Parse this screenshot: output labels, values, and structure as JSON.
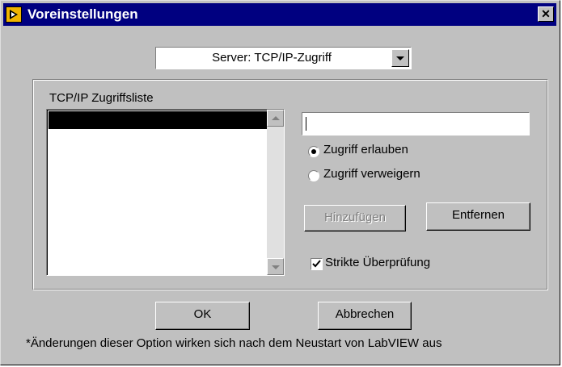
{
  "window": {
    "title": "Voreinstellungen",
    "close_glyph": "✕",
    "icon": "labview-icon"
  },
  "category_select": {
    "value": "Server: TCP/IP-Zugriff"
  },
  "access_list": {
    "label": "TCP/IP Zugriffsliste",
    "items": [
      ""
    ],
    "selected_index": 0
  },
  "address_input": {
    "value": ""
  },
  "access_mode": {
    "options": [
      {
        "label": "Zugriff erlauben",
        "selected": true
      },
      {
        "label": "Zugriff verweigern",
        "selected": false
      }
    ]
  },
  "buttons": {
    "add": {
      "label": "Hinzufügen",
      "enabled": false
    },
    "remove": {
      "label": "Entfernen",
      "enabled": true
    },
    "ok": {
      "label": "OK"
    },
    "cancel": {
      "label": "Abbrechen"
    }
  },
  "strict_check": {
    "label": "Strikte Überprüfung",
    "checked": true
  },
  "footnote": "*Änderungen dieser Option wirken sich nach dem Neustart von LabVIEW aus"
}
